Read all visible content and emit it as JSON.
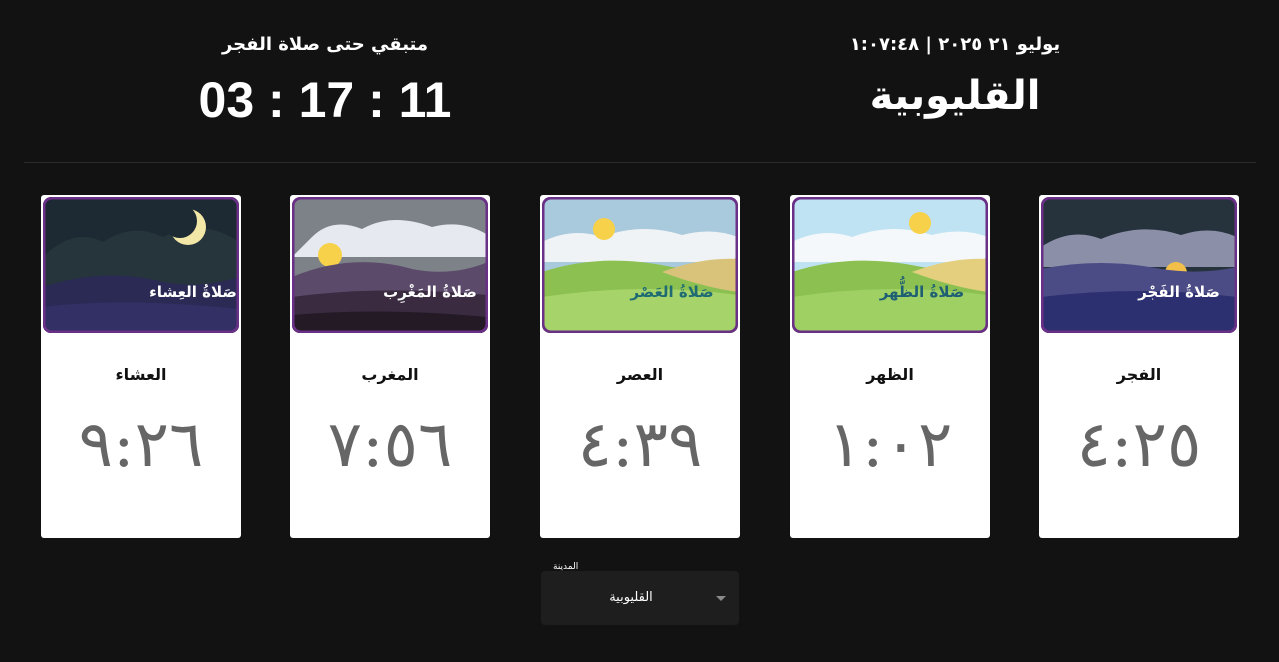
{
  "header": {
    "date_line": "يوليو ٢١ ٢٠٢٥ | ١:٠٧:٤٨",
    "city": "القليوبية"
  },
  "countdown": {
    "label": "متبقي حتى صلاة الفجر",
    "value": "03 : 17 : 11"
  },
  "prayers": [
    {
      "id": "isha",
      "name": "العشاء",
      "time": "٩:٢٦",
      "image_caption": "صَلاةُ العِشاء"
    },
    {
      "id": "maghrib",
      "name": "المغرب",
      "time": "٧:٥٦",
      "image_caption": "صَلاةُ المَغْرِب"
    },
    {
      "id": "asr",
      "name": "العصر",
      "time": "٤:٣٩",
      "image_caption": "صَلاةُ العَصْر"
    },
    {
      "id": "dhuhr",
      "name": "الظهر",
      "time": "١:٠٢",
      "image_caption": "صَلاةُ الظُّهر"
    },
    {
      "id": "fajr",
      "name": "الفجر",
      "time": "٤:٢٥",
      "image_caption": "صَلاةُ الفَجْر"
    }
  ],
  "city_select": {
    "label": "المدينة",
    "value": "القليوبية"
  },
  "colors": {
    "background": "#121212",
    "card_border_accent": "#6a2f86",
    "time_text": "#666666"
  }
}
